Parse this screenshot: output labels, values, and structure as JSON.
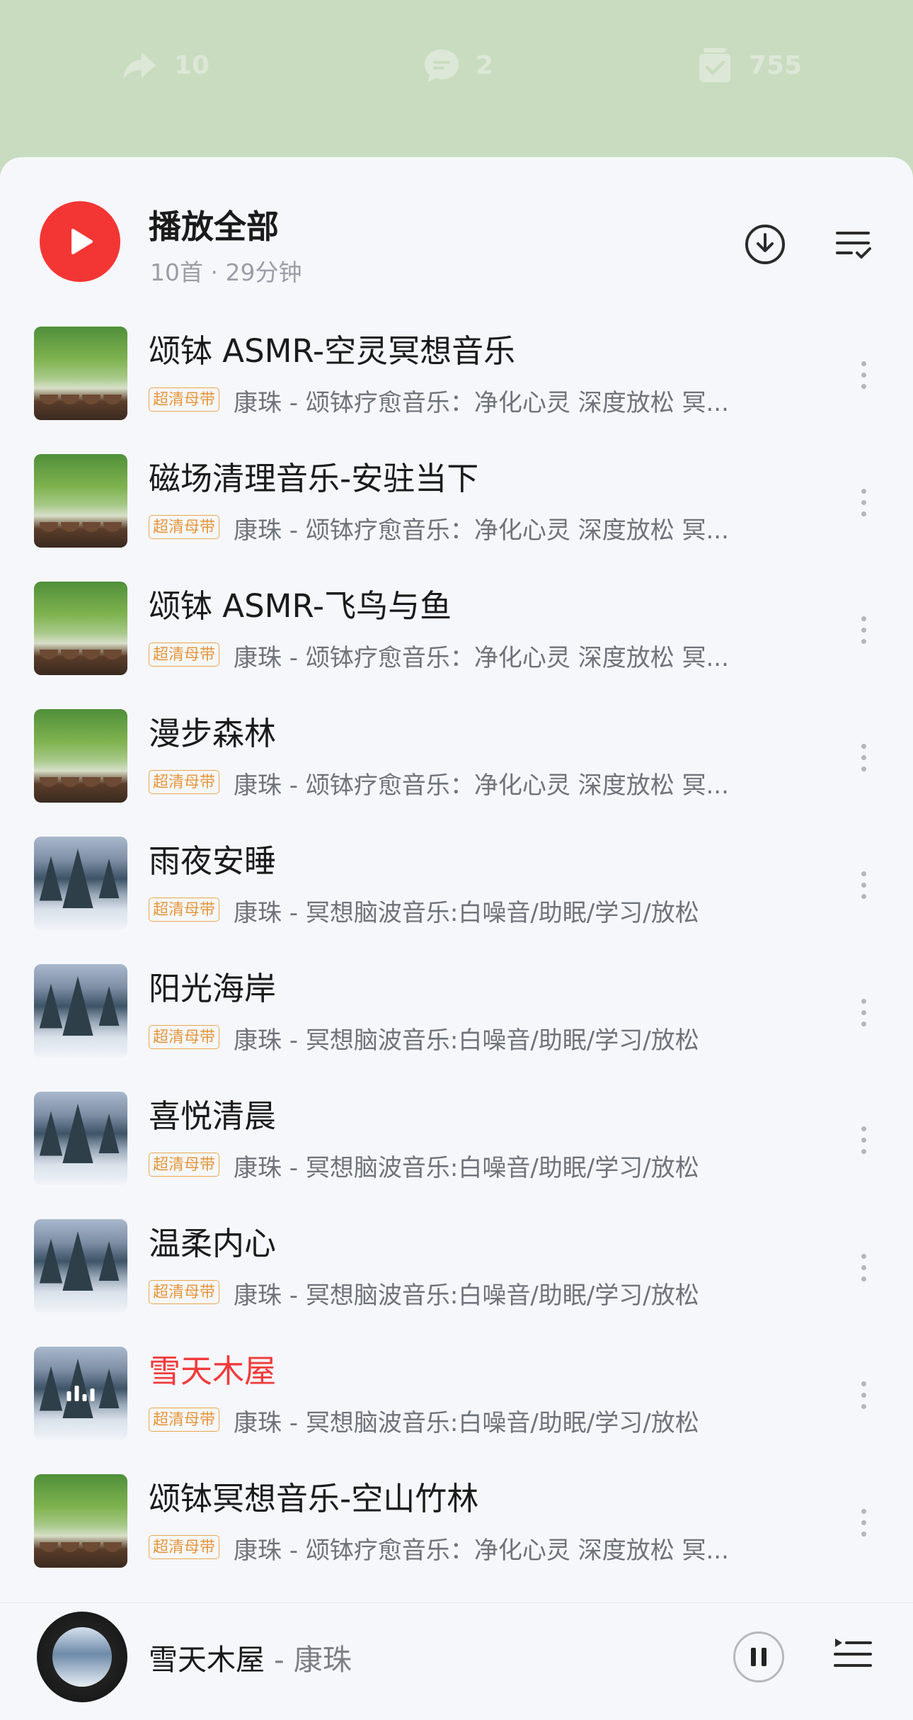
{
  "top_actions": {
    "share_count": "10",
    "comment_count": "2",
    "collect_count": "755"
  },
  "header": {
    "play_all_label": "播放全部",
    "meta": "10首 · 29分钟"
  },
  "songs": [
    {
      "title": "颂钵 ASMR-空灵冥想音乐",
      "badge": "超清母带",
      "subtitle": "康珠 - 颂钵疗愈音乐：净化心灵 深度放松 冥...",
      "cover": "forest"
    },
    {
      "title": "磁场清理音乐-安驻当下",
      "badge": "超清母带",
      "subtitle": "康珠 - 颂钵疗愈音乐：净化心灵 深度放松 冥...",
      "cover": "forest"
    },
    {
      "title": "颂钵 ASMR-飞鸟与鱼",
      "badge": "超清母带",
      "subtitle": "康珠 - 颂钵疗愈音乐：净化心灵 深度放松 冥...",
      "cover": "forest"
    },
    {
      "title": "漫步森林",
      "badge": "超清母带",
      "subtitle": "康珠 - 颂钵疗愈音乐：净化心灵 深度放松 冥...",
      "cover": "forest"
    },
    {
      "title": "雨夜安睡",
      "badge": "超清母带",
      "subtitle": "康珠 - 冥想脑波音乐:白噪音/助眠/学习/放松",
      "cover": "snow"
    },
    {
      "title": "阳光海岸",
      "badge": "超清母带",
      "subtitle": "康珠 - 冥想脑波音乐:白噪音/助眠/学习/放松",
      "cover": "snow"
    },
    {
      "title": "喜悦清晨",
      "badge": "超清母带",
      "subtitle": "康珠 - 冥想脑波音乐:白噪音/助眠/学习/放松",
      "cover": "snow"
    },
    {
      "title": "温柔内心",
      "badge": "超清母带",
      "subtitle": "康珠 - 冥想脑波音乐:白噪音/助眠/学习/放松",
      "cover": "snow"
    },
    {
      "title": "雪天木屋",
      "badge": "超清母带",
      "subtitle": "康珠 - 冥想脑波音乐:白噪音/助眠/学习/放松",
      "cover": "snow",
      "playing": true
    },
    {
      "title": "颂钵冥想音乐-空山竹林",
      "badge": "超清母带",
      "subtitle": "康珠 - 颂钵疗愈音乐：净化心灵 深度放松 冥...",
      "cover": "forest"
    }
  ],
  "now_playing": {
    "title": "雪天木屋",
    "artist": " - 康珠"
  },
  "colors": {
    "accent_red": "#f33634",
    "badge_gold": "#e4963a",
    "top_background": "#c9dcc0"
  }
}
